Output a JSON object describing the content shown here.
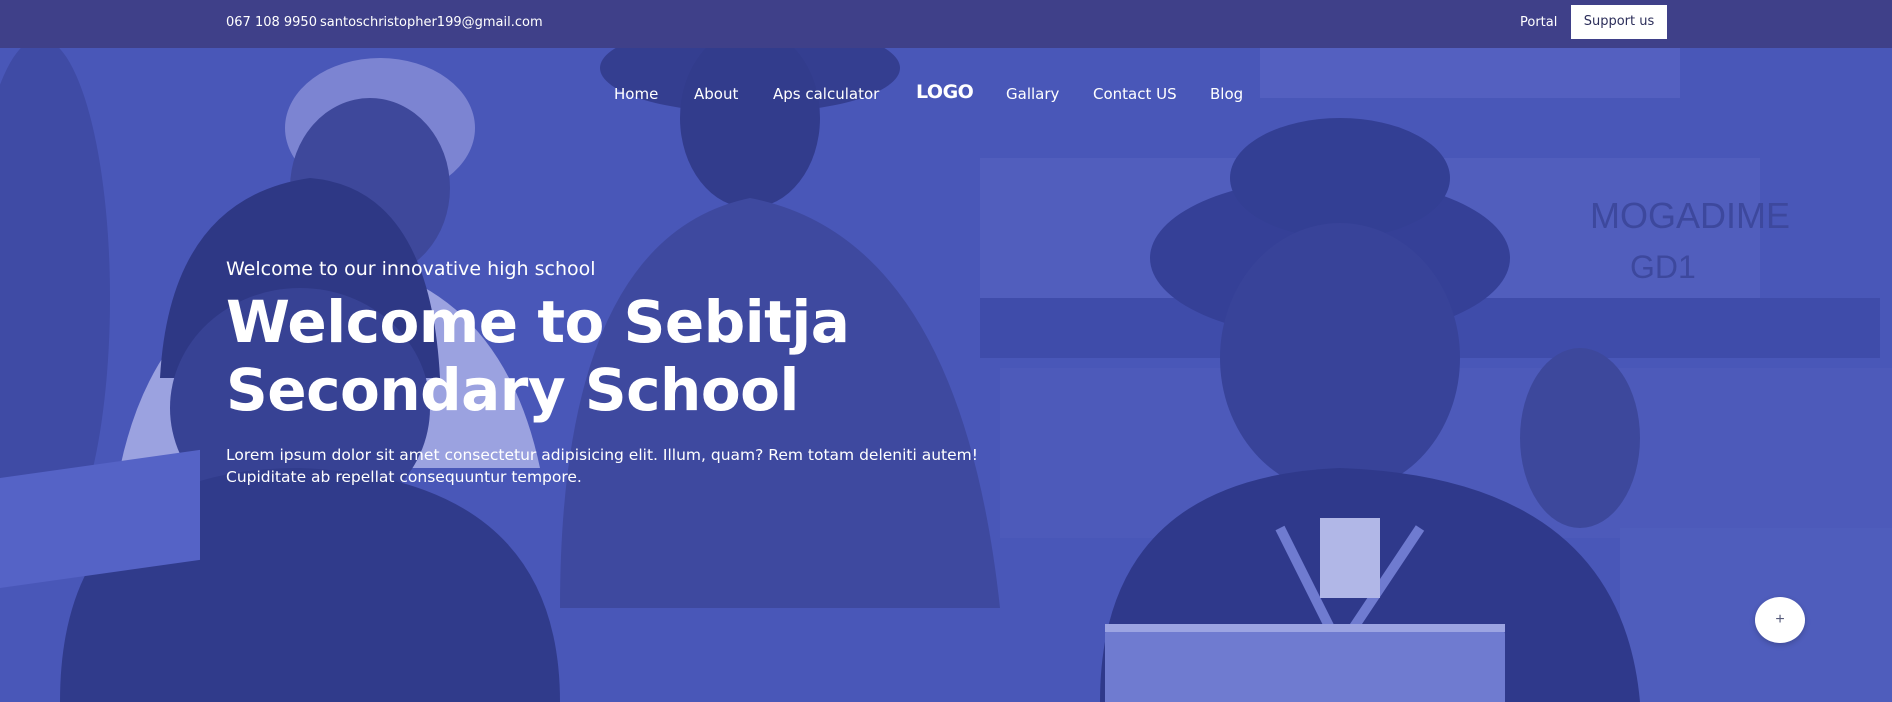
{
  "topbar": {
    "phone": "067 108 9950",
    "email": "santoschristopher199@gmail.com",
    "portal_label": "Portal",
    "support_label": "Support us"
  },
  "nav": {
    "items": [
      {
        "label": "Home"
      },
      {
        "label": "About"
      },
      {
        "label": "Aps calculator"
      },
      {
        "label": "Gallary"
      },
      {
        "label": "Contact US"
      },
      {
        "label": "Blog"
      }
    ],
    "logo": "LOGO"
  },
  "hero": {
    "eyebrow": "Welcome to our innovative high school",
    "headline_line1": "Welcome to Sebitja",
    "headline_line2": "Secondary School",
    "description": "Lorem ipsum dolor sit amet consectetur adipisicing elit. Illum, quam? Rem totam deleniti autem! Cupiditate ab repellat consequuntur tempore."
  },
  "fab": {
    "icon": "plus-icon",
    "symbol": "+"
  },
  "colors": {
    "topbar_bg": "#3f4089",
    "hero_tint": "#4553b3",
    "text": "#ffffff",
    "button_bg": "#ffffff",
    "button_text": "#2c2e5a"
  }
}
